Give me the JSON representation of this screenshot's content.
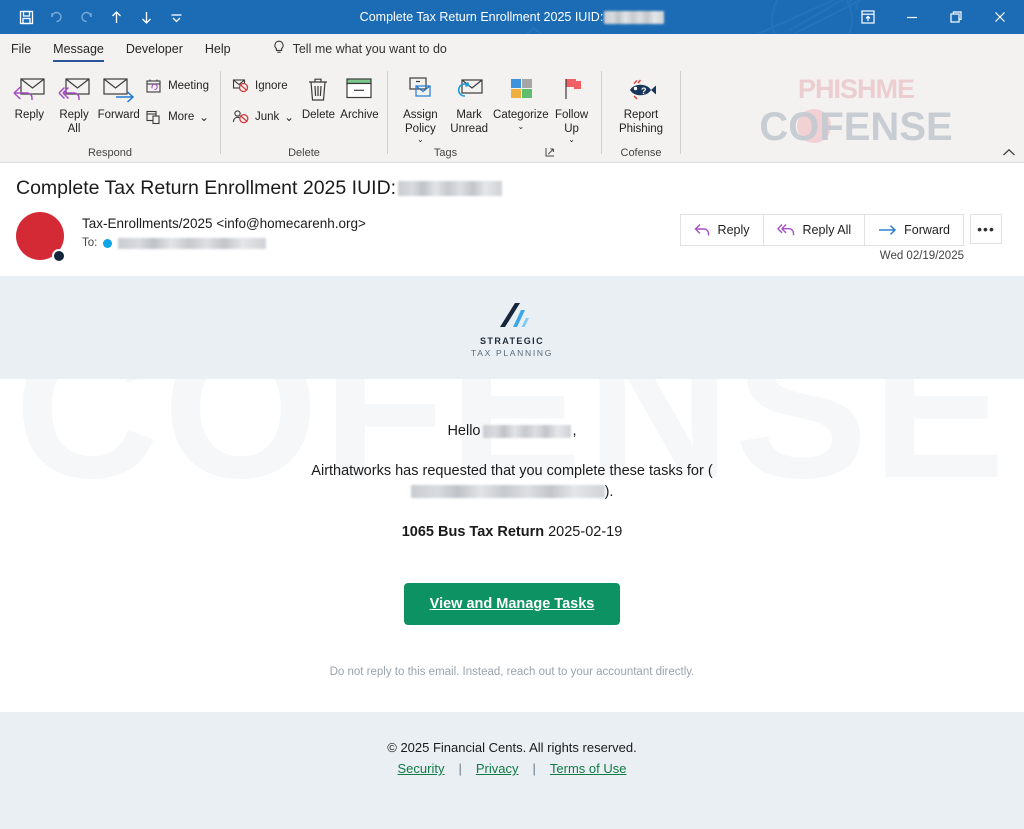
{
  "window": {
    "title": "Complete Tax Return Enrollment 2025 IUID:",
    "title_redacted": true,
    "quick_access": [
      {
        "name": "save",
        "icon": "save-icon",
        "enabled": true
      },
      {
        "name": "undo",
        "icon": "undo-icon",
        "enabled": false
      },
      {
        "name": "redo",
        "icon": "redo-icon",
        "enabled": false
      },
      {
        "name": "previous-item",
        "icon": "arrow-up-icon",
        "enabled": true
      },
      {
        "name": "next-item",
        "icon": "arrow-down-icon",
        "enabled": true
      },
      {
        "name": "customize-quick-access",
        "icon": "chevron-down-icon",
        "enabled": true
      }
    ],
    "controls": [
      {
        "name": "ribbon-display-options",
        "icon": "ribbon-display-icon"
      },
      {
        "name": "minimize",
        "icon": "minimize-icon"
      },
      {
        "name": "restore",
        "icon": "restore-icon"
      },
      {
        "name": "close",
        "icon": "close-icon"
      }
    ],
    "accent_color": "#1c6cb5"
  },
  "tabs": {
    "items": [
      {
        "label": "File",
        "active": false
      },
      {
        "label": "Message",
        "active": true
      },
      {
        "label": "Developer",
        "active": false
      },
      {
        "label": "Help",
        "active": false
      }
    ],
    "tell_me": "Tell me what you want to do",
    "tell_me_icon": "lightbulb-icon"
  },
  "ribbon": {
    "groups": [
      {
        "label": "Respond",
        "big_buttons": [
          {
            "label": "Reply",
            "icon": "reply-icon"
          },
          {
            "label": "Reply All",
            "icon": "reply-all-icon"
          },
          {
            "label": "Forward",
            "icon": "forward-icon"
          }
        ],
        "small_buttons": [
          {
            "label": "Meeting",
            "icon": "meeting-icon",
            "has_chevron": false
          },
          {
            "label": "More",
            "icon": "more-items-icon",
            "has_chevron": true
          }
        ]
      },
      {
        "label": "Delete",
        "big_buttons": [
          {
            "label": "Delete",
            "icon": "trash-icon"
          },
          {
            "label": "Archive",
            "icon": "archive-icon"
          }
        ],
        "small_buttons": [
          {
            "label": "Ignore",
            "icon": "ignore-icon",
            "has_chevron": false
          },
          {
            "label": "Junk",
            "icon": "junk-icon",
            "has_chevron": true
          }
        ]
      },
      {
        "label": "Tags",
        "has_dialog_launcher": true,
        "big_buttons": [
          {
            "label": "Assign Policy",
            "icon": "assign-policy-icon",
            "has_chevron": true
          },
          {
            "label": "Mark Unread",
            "icon": "mark-unread-icon",
            "has_chevron": false
          },
          {
            "label": "Categorize",
            "icon": "categorize-icon",
            "has_chevron": true
          },
          {
            "label": "Follow Up",
            "icon": "follow-up-flag-icon",
            "has_chevron": true
          }
        ],
        "small_buttons": []
      },
      {
        "label": "Cofense",
        "big_buttons": [
          {
            "label": "Report Phishing",
            "icon": "phish-fish-icon"
          }
        ],
        "small_buttons": []
      }
    ],
    "collapse_icon": "chevron-up-icon",
    "brand_watermark": {
      "top": "PHISHME",
      "bottom": "COFENSE"
    }
  },
  "email": {
    "subject": "Complete Tax Return Enrollment 2025 IUID:",
    "subject_redacted": true,
    "sender": "Tax-Enrollments/2025 <info@homecarenh.org>",
    "to_label": "To:",
    "to_redacted": true,
    "date": "Wed 02/19/2025",
    "avatar_color": "#d42a35",
    "actions": [
      {
        "label": "Reply",
        "icon": "reply-icon"
      },
      {
        "label": "Reply All",
        "icon": "reply-all-icon"
      },
      {
        "label": "Forward",
        "icon": "forward-icon"
      }
    ],
    "more_actions_label": "•••"
  },
  "message_body": {
    "brand": {
      "name": "STRATEGIC",
      "subname": "TAX PLANNING",
      "mark_icon": "ascending-bars-icon"
    },
    "greeting_prefix": "Hello",
    "greeting_suffix": ",",
    "greeting_redacted": true,
    "paragraph_before": "Airthatworks has requested that you complete these tasks for",
    "paragraph_open_paren": "(",
    "paragraph_close_paren": ").",
    "paragraph_redacted": true,
    "task_name": "1065 Bus Tax Return",
    "task_date": "2025-02-19",
    "cta_label": "View and Manage Tasks",
    "cta_color": "#0d9263",
    "disclaimer": "Do not reply to this email. Instead, reach out to your accountant directly.",
    "band_color": "#eaeff4",
    "watermark_text": "COFENSE"
  },
  "footer": {
    "copyright": "© 2025 Financial Cents. All rights reserved.",
    "links": [
      {
        "label": "Security"
      },
      {
        "label": "Privacy"
      },
      {
        "label": "Terms of Use"
      }
    ],
    "divider": "|",
    "link_color": "#117a45"
  }
}
